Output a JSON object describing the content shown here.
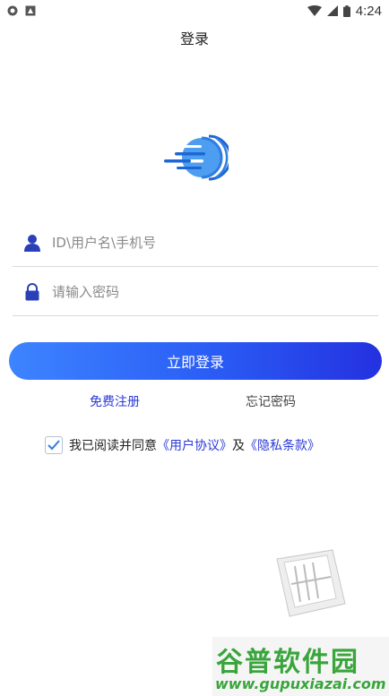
{
  "status_bar": {
    "time": "4:24"
  },
  "header": {
    "title": "登录"
  },
  "form": {
    "username_placeholder": "ID\\用户名\\手机号",
    "password_placeholder": "请输入密码",
    "login_label": "立即登录",
    "register_label": "免费注册",
    "forgot_label": "忘记密码"
  },
  "agreement": {
    "checked": true,
    "prefix": "我已阅读并同意",
    "user_agreement": "《用户协议》",
    "conjunction": "及",
    "privacy_policy": "《隐私条款》"
  },
  "watermark": {
    "title": "谷普软件园",
    "url": "www.gupuxiazai.com"
  },
  "colors": {
    "primary": "#2b39d8",
    "button_start": "#3d84ff",
    "button_end": "#2431e0",
    "watermark_green": "#39a53b"
  }
}
